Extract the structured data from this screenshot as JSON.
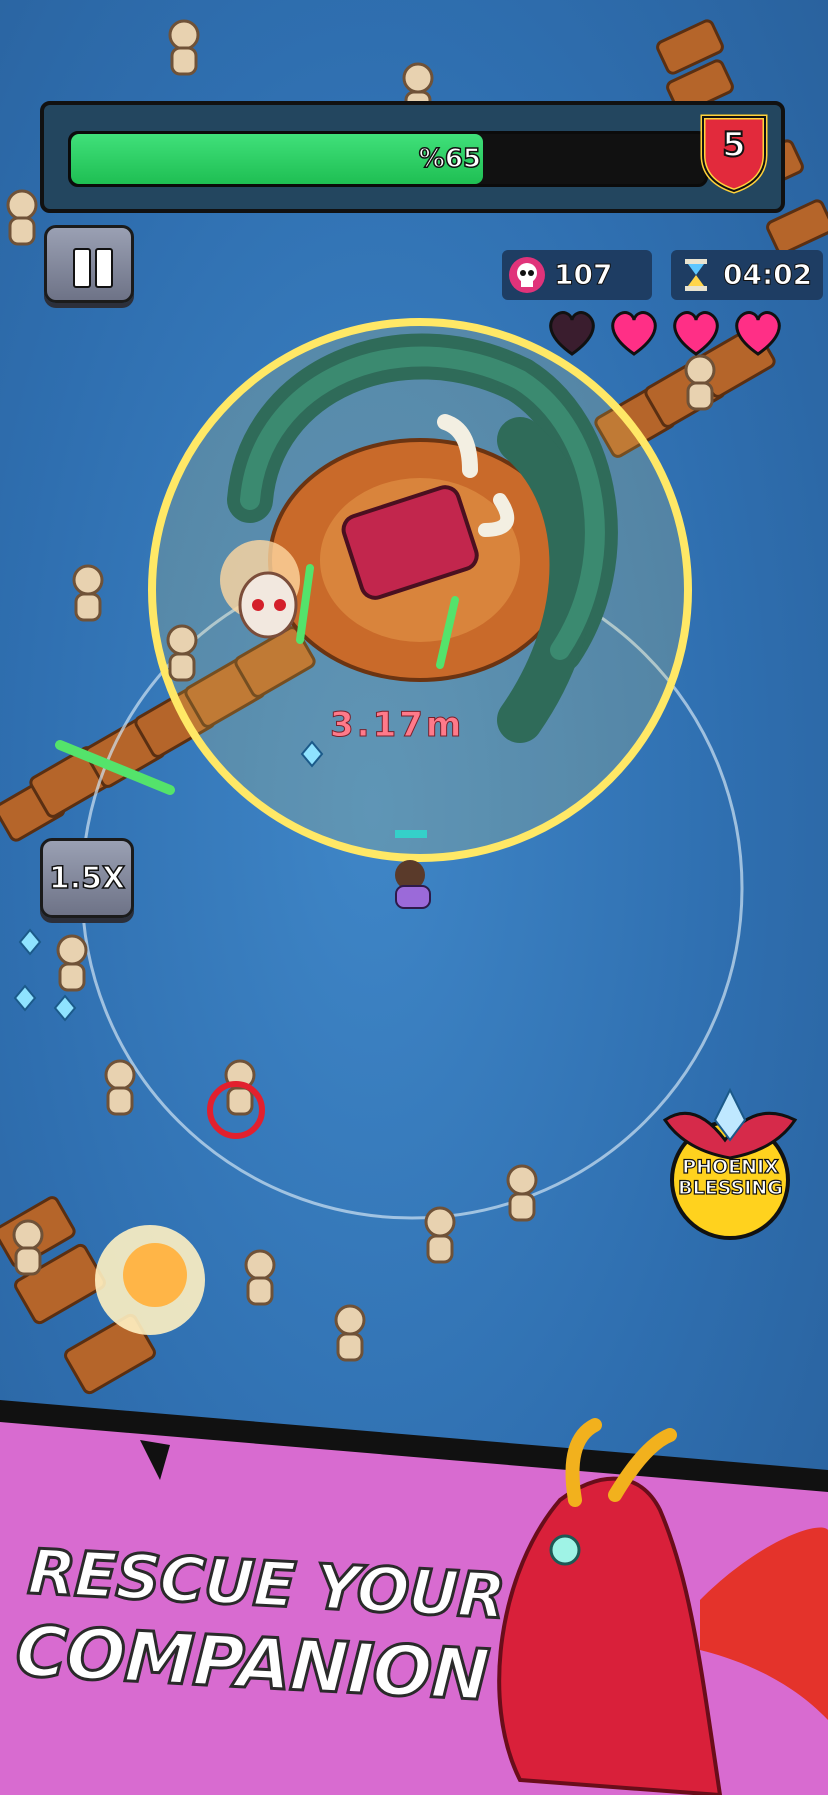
{
  "hud": {
    "progress_label": "%65",
    "progress_fraction": 0.65,
    "level": "5",
    "kills": "107",
    "timer": "04:02",
    "hearts_total": 4,
    "hearts_filled": 3
  },
  "controls": {
    "speed_label": "1.5X"
  },
  "arena": {
    "distance_label": "3.17m"
  },
  "powerup": {
    "line1": "PHOENIX",
    "line2": "BLESSING"
  },
  "banner": {
    "line1": "RESCUE YOUR",
    "line2": "COMPANION"
  },
  "colors": {
    "progress_fill": "#2ad464",
    "heart_filled": "#ff2f86",
    "heart_empty": "#3a1d2e",
    "banner_bg": "#d86bd0",
    "level_badge": "#e22a3c"
  }
}
